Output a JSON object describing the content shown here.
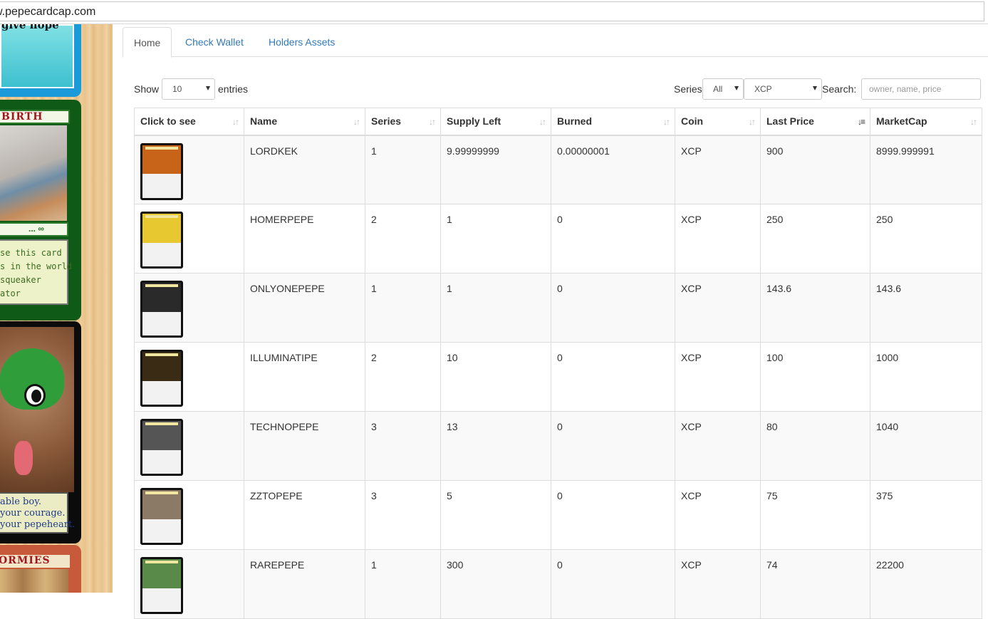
{
  "browser": {
    "url": "w.pepecardcap.com"
  },
  "side_cards": {
    "card1_caption": "give hope",
    "card2_banner": "BIRTH",
    "card2_bar": "... ∞",
    "card2_text": [
      "se this card",
      "s in the world",
      "squeaker",
      "ator"
    ],
    "card3_text": [
      "able boy.",
      "your courage.",
      "your pepeheart."
    ],
    "card4_banner": "ORMIES"
  },
  "tabs": [
    {
      "label": "Home",
      "active": true
    },
    {
      "label": "Check Wallet",
      "active": false
    },
    {
      "label": "Holders Assets",
      "active": false
    }
  ],
  "controls": {
    "show_label": "Show",
    "entries_value": "10",
    "entries_label": "entries",
    "series_label": "Series",
    "series_value": "All",
    "coin_value": "XCP",
    "search_label": "Search:",
    "search_placeholder": "owner, name, price"
  },
  "table": {
    "columns": [
      "Click to see",
      "Name",
      "Series",
      "Supply Left",
      "Burned",
      "Coin",
      "Last Price",
      "MarketCap"
    ],
    "sorted_column": "Last Price",
    "rows": [
      {
        "name": "LORDKEK",
        "series": "1",
        "supply": "9.99999999",
        "burned": "0.00000001",
        "coin": "XCP",
        "price": "900",
        "mcap": "8999.999991",
        "thumb": "#c8641a"
      },
      {
        "name": "HOMERPEPE",
        "series": "2",
        "supply": "1",
        "burned": "0",
        "coin": "XCP",
        "price": "250",
        "mcap": "250",
        "thumb": "#e8c830"
      },
      {
        "name": "ONLYONEPEPE",
        "series": "1",
        "supply": "1",
        "burned": "0",
        "coin": "XCP",
        "price": "143.6",
        "mcap": "143.6",
        "thumb": "#2a2a2a"
      },
      {
        "name": "ILLUMINATIPE",
        "series": "2",
        "supply": "10",
        "burned": "0",
        "coin": "XCP",
        "price": "100",
        "mcap": "1000",
        "thumb": "#3a2c14"
      },
      {
        "name": "TECHNOPEPE",
        "series": "3",
        "supply": "13",
        "burned": "0",
        "coin": "XCP",
        "price": "80",
        "mcap": "1040",
        "thumb": "#555555"
      },
      {
        "name": "ZZTOPEPE",
        "series": "3",
        "supply": "5",
        "burned": "0",
        "coin": "XCP",
        "price": "75",
        "mcap": "375",
        "thumb": "#8a7a66"
      },
      {
        "name": "RAREPEPE",
        "series": "1",
        "supply": "300",
        "burned": "0",
        "coin": "XCP",
        "price": "74",
        "mcap": "22200",
        "thumb": "#5a8a4a"
      }
    ]
  }
}
